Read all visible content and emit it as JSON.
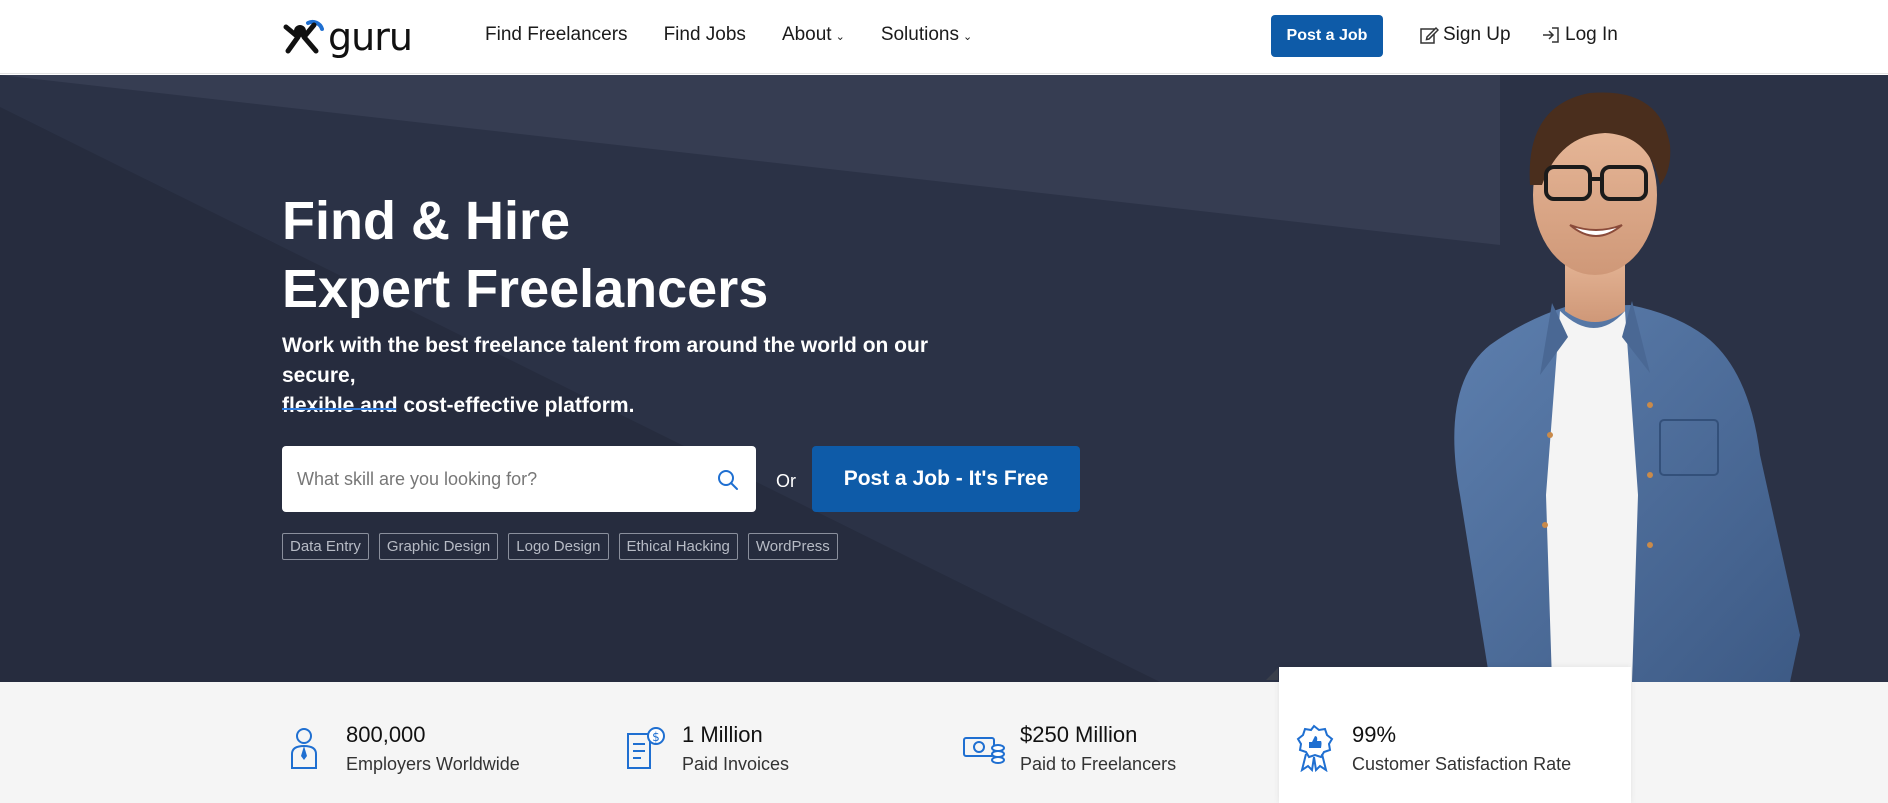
{
  "header": {
    "logo_text": "guru",
    "nav": [
      {
        "label": "Find Freelancers",
        "has_dropdown": false
      },
      {
        "label": "Find Jobs",
        "has_dropdown": false
      },
      {
        "label": "About",
        "has_dropdown": true
      },
      {
        "label": "Solutions",
        "has_dropdown": true
      }
    ],
    "post_job_label": "Post a Job",
    "signup_label": "Sign Up",
    "login_label": "Log In"
  },
  "hero": {
    "title_line1": "Find & Hire",
    "title_line2": "Expert Freelancers",
    "subtitle_line1": "Work with the best freelance talent from around the world on our secure,",
    "subtitle_line2": "flexible and cost-effective platform.",
    "search_placeholder": "What skill are you looking for?",
    "or_label": "Or",
    "cta_label": "Post a Job - It's Free",
    "tags": [
      "Data Entry",
      "Graphic Design",
      "Logo Design",
      "Ethical Hacking",
      "WordPress"
    ]
  },
  "stats": [
    {
      "value": "800,000",
      "label": "Employers Worldwide",
      "icon": "employer-icon"
    },
    {
      "value": "1 Million",
      "label": "Paid Invoices",
      "icon": "invoice-icon"
    },
    {
      "value": "$250 Million",
      "label": "Paid to Freelancers",
      "icon": "money-icon"
    },
    {
      "value": "99%",
      "label": "Customer Satisfaction Rate",
      "icon": "award-icon"
    }
  ],
  "colors": {
    "brand_blue": "#0e5ba8",
    "hero_bg": "#2b3246",
    "accent_line": "#2f7de0"
  }
}
